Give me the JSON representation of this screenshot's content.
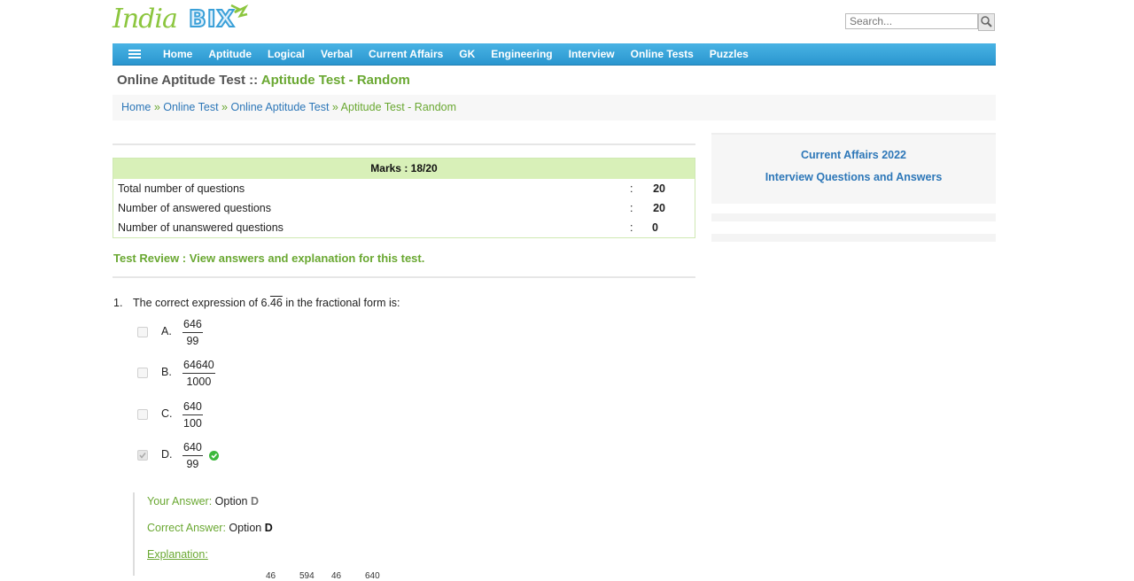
{
  "site": {
    "logo_india": "India",
    "logo_bix": "BIX"
  },
  "search": {
    "placeholder": "Search..."
  },
  "nav": {
    "items": [
      "Home",
      "Aptitude",
      "Logical",
      "Verbal",
      "Current Affairs",
      "GK",
      "Engineering",
      "Interview",
      "Online Tests",
      "Puzzles"
    ]
  },
  "page": {
    "title_prefix": "Online Aptitude Test :: ",
    "title_highlight": "Aptitude Test - Random"
  },
  "breadcrumb": {
    "items": [
      "Home",
      "Online Test",
      "Online Aptitude Test"
    ],
    "separator": " » ",
    "current": "Aptitude Test - Random"
  },
  "marks": {
    "heading": "Marks : 18/20",
    "rows": [
      {
        "label": "Total number of questions",
        "colon": ":",
        "value": "20"
      },
      {
        "label": "Number of answered questions",
        "colon": ":",
        "value": "20"
      },
      {
        "label": "Number of unanswered questions",
        "colon": ":",
        "value": "0"
      }
    ]
  },
  "review": {
    "text": "Test Review : View answers and explanation for this test."
  },
  "question": {
    "number": "1.",
    "text_before": "The correct expression of 6.",
    "text_overline": "46",
    "text_after": " in the fractional form is:",
    "options": [
      {
        "letter": "A.",
        "numerator": "646",
        "denominator": "99",
        "checked": false,
        "correct": false
      },
      {
        "letter": "B.",
        "numerator": "64640",
        "denominator": "1000",
        "checked": false,
        "correct": false
      },
      {
        "letter": "C.",
        "numerator": "640",
        "denominator": "100",
        "checked": false,
        "correct": false
      },
      {
        "letter": "D.",
        "numerator": "640",
        "denominator": "99",
        "checked": true,
        "correct": true
      }
    ]
  },
  "answer": {
    "your_label": "Your Answer:",
    "your_value_prefix": " Option ",
    "your_value": "D",
    "correct_label": "Correct Answer:",
    "correct_value_prefix": " Option ",
    "correct_value": "D",
    "explanation_label": "Explanation:",
    "explanation_partial": [
      "46",
      "594",
      "46",
      "640"
    ]
  },
  "sidebar": {
    "links": [
      "Current Affairs 2022",
      "Interview Questions and Answers"
    ]
  },
  "colors": {
    "accent_green": "#6aa832",
    "link_blue": "#2d77b8",
    "nav_blue": "#2a96cf"
  }
}
